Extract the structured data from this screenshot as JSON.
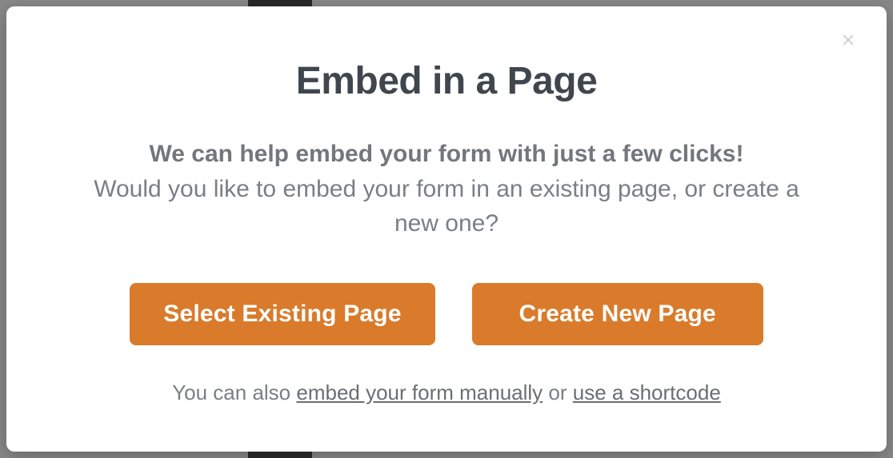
{
  "modal": {
    "title": "Embed in a Page",
    "subtitle_strong": "We can help embed your form with just a few clicks!",
    "subtitle": "Would you like to embed your form in an existing page, or create a new one?",
    "buttons": {
      "select_existing": "Select Existing Page",
      "create_new": "Create New Page"
    },
    "footer": {
      "prefix": "You can also ",
      "link_manual": "embed your form manually",
      "middle": " or ",
      "link_shortcode": "use a shortcode"
    }
  }
}
